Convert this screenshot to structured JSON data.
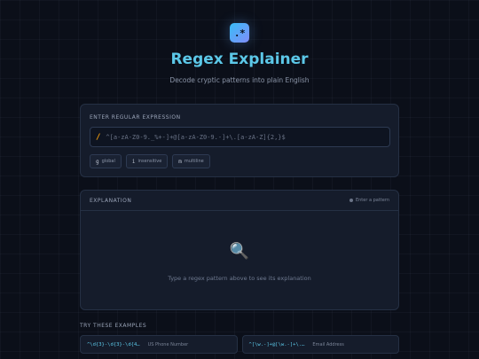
{
  "header": {
    "logo_glyph": ".*",
    "title": "Regex Explainer",
    "subtitle": "Decode cryptic patterns into plain English"
  },
  "input_card": {
    "label": "ENTER REGULAR EXPRESSION",
    "slash": "/",
    "placeholder": "^[a-zA-Z0-9._%+-]+@[a-zA-Z0-9.-]+\\.[a-zA-Z]{2,}$",
    "value": "",
    "flags": [
      {
        "glyph": "g",
        "label": "global"
      },
      {
        "glyph": "i",
        "label": "insensitive"
      },
      {
        "glyph": "m",
        "label": "multiline"
      }
    ]
  },
  "explanation_card": {
    "label": "EXPLANATION",
    "status": "Enter a pattern",
    "empty_icon": "magnifier-icon",
    "empty_text": "Type a regex pattern above to see its explanation"
  },
  "examples": {
    "label": "TRY THESE EXAMPLES",
    "items": [
      {
        "pattern": "^\\d{3}-\\d{3}-\\d{4…",
        "name": "US Phone Number"
      },
      {
        "pattern": "^[\\w.-]+@[\\w.-]+\\.…",
        "name": "Email Address"
      }
    ]
  },
  "colors": {
    "accent": "#5cc8e8",
    "slash": "#f59e0b",
    "background": "#0b0f19",
    "card": "#151c2b"
  }
}
